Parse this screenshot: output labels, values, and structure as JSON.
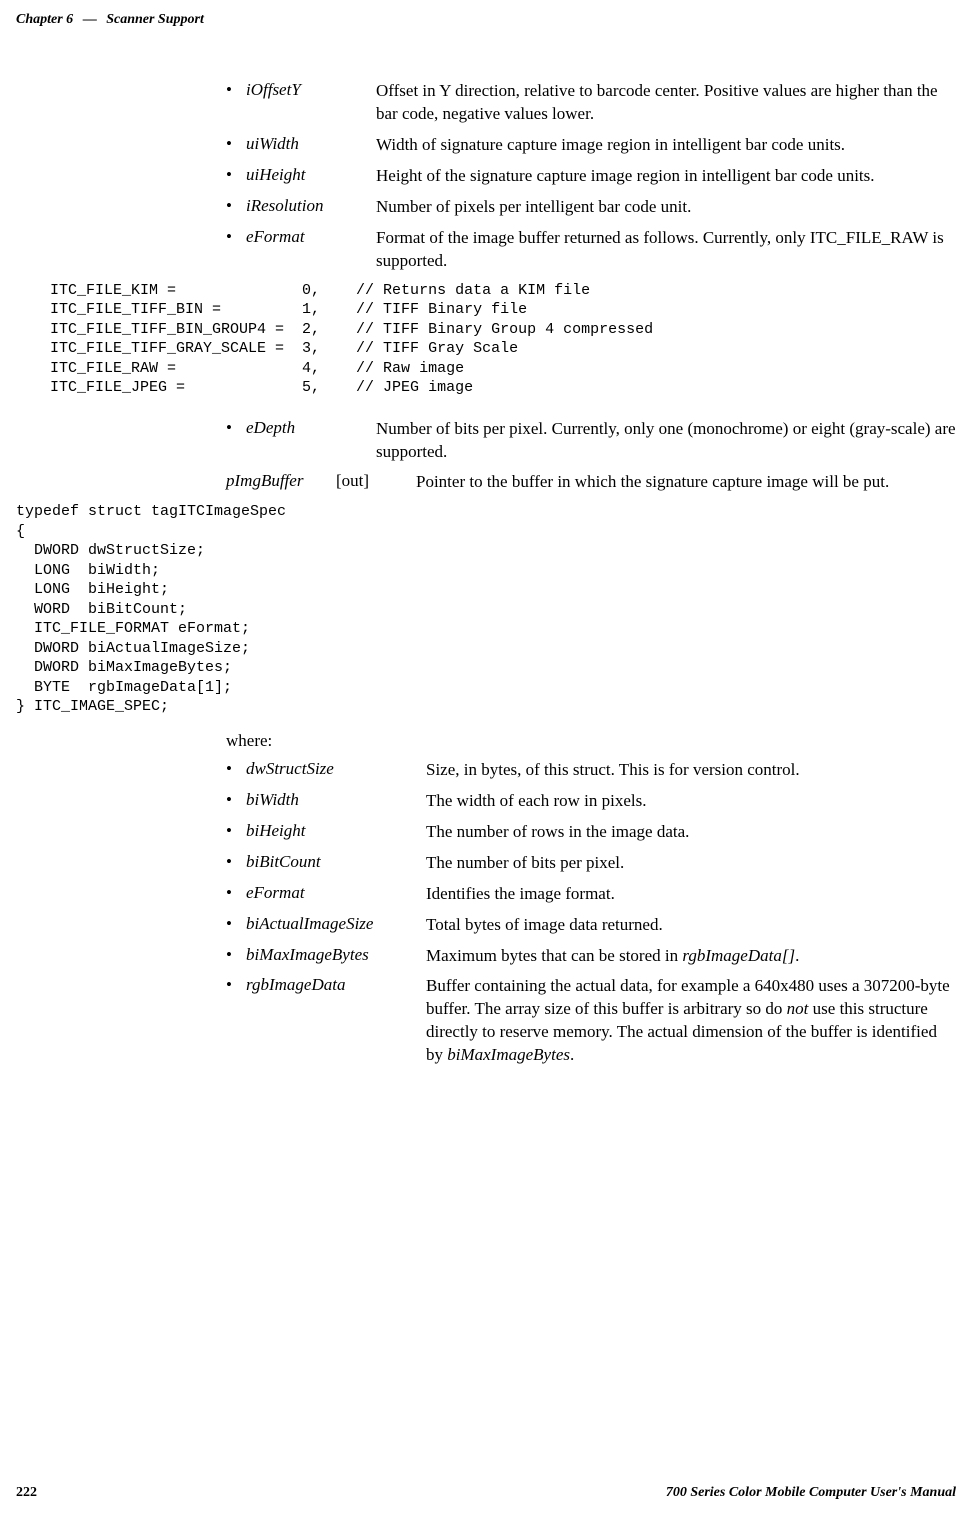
{
  "header": {
    "chapter": "Chapter 6",
    "sep": "—",
    "title": "Scanner Support"
  },
  "params1": [
    {
      "name": "iOffsetY",
      "desc": "Offset in Y direction, relative to barcode center. Positive values are higher than the bar code, negative values lower."
    },
    {
      "name": "uiWidth",
      "desc": "Width of signature capture image region in intelligent bar code units."
    },
    {
      "name": "uiHeight",
      "desc": "Height of the signature capture image region in intelligent bar code units."
    },
    {
      "name": "iResolution",
      "desc": "Number of pixels per intelligent bar code unit."
    },
    {
      "name": "eFormat",
      "desc": "Format of the image buffer returned as follows. Currently, only ITC_FILE_RAW is supported."
    }
  ],
  "enumBlock": "  ITC_FILE_KIM =              0,    // Returns data a KIM file\n  ITC_FILE_TIFF_BIN =         1,    // TIFF Binary file\n  ITC_FILE_TIFF_BIN_GROUP4 =  2,    // TIFF Binary Group 4 compressed\n  ITC_FILE_TIFF_GRAY_SCALE =  3,    // TIFF Gray Scale\n  ITC_FILE_RAW =              4,    // Raw image\n  ITC_FILE_JPEG =             5,    // JPEG image",
  "params2": [
    {
      "name": "eDepth",
      "desc": "Number of bits per pixel. Currently, only one (monochrome) or eight (gray-scale) are supported."
    }
  ],
  "pimg": {
    "name": "pImgBuffer",
    "dir": "[out]",
    "desc": "Pointer to the buffer in which the signature capture image will be put."
  },
  "typedefBlock": "typedef struct tagITCImageSpec\n{\n  DWORD dwStructSize;\n  LONG  biWidth;\n  LONG  biHeight;\n  WORD  biBitCount;\n  ITC_FILE_FORMAT eFormat;\n  DWORD biActualImageSize;\n  DWORD biMaxImageBytes;\n  BYTE  rgbImageData[1];\n} ITC_IMAGE_SPEC;",
  "whereLabel": "where:",
  "whereList": [
    {
      "name": "dwStructSize",
      "desc": "Size, in bytes, of this struct. This is for version control."
    },
    {
      "name": "biWidth",
      "desc": "The width of each row in pixels."
    },
    {
      "name": "biHeight",
      "desc": "The number of rows in the image data."
    },
    {
      "name": "biBitCount",
      "desc": "The number of bits per pixel."
    },
    {
      "name": "eFormat",
      "desc": "Identifies the image format."
    },
    {
      "name": "biActualImageSize",
      "desc": "Total bytes of image data returned."
    },
    {
      "name": "biMaxImageBytes",
      "descPrefix": "Maximum bytes that can be stored in ",
      "descItalic": "rgbImageData[]",
      "descSuffix": "."
    },
    {
      "name": "rgbImageData",
      "descPrefix": "Buffer containing the actual data, for example a 640x480 uses a 307200-byte buffer. The array size of this buffer is arbitrary so do ",
      "descItalic": "not",
      "descMiddle": " use this structure directly to reserve memory. The actual dimension of the buffer is identified by ",
      "descItalic2": "biMaxImageBytes",
      "descSuffix": "."
    }
  ],
  "footer": {
    "page": "222",
    "title": "700 Series Color Mobile Computer User's Manual"
  },
  "bullet": "•"
}
